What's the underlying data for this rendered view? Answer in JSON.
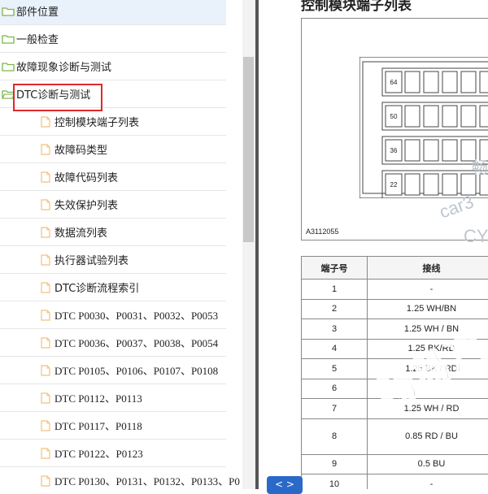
{
  "tree": {
    "folders": [
      {
        "label": "部件位置"
      },
      {
        "label": "一般检查"
      },
      {
        "label": "故障现象诊断与测试"
      },
      {
        "label": "DTC诊断与测试"
      }
    ],
    "pages": [
      {
        "label": "控制模块端子列表"
      },
      {
        "label": "故障码类型"
      },
      {
        "label": "故障代码列表"
      },
      {
        "label": "失效保护列表"
      },
      {
        "label": "数据流列表"
      },
      {
        "label": "执行器试验列表"
      },
      {
        "label": "DTC诊断流程索引"
      },
      {
        "label": "DTC P0030、P0031、P0032、P0053"
      },
      {
        "label": "DTC P0036、P0037、P0038、P0054"
      },
      {
        "label": "DTC P0105、P0106、P0107、P0108"
      },
      {
        "label": "DTC P0112、P0113"
      },
      {
        "label": "DTC P0117、P0118"
      },
      {
        "label": "DTC P0122、P0123"
      },
      {
        "label": "DTC P0130、P0131、P0132、P0133、P0"
      }
    ]
  },
  "doc": {
    "title": "控制模块端子列表",
    "figure_label": "A3112055",
    "connector_pins": [
      "64",
      "50",
      "36",
      "22"
    ],
    "table": {
      "headers": [
        "端子号",
        "接线"
      ],
      "rows": [
        [
          "1",
          "-"
        ],
        [
          "2",
          "1.25 WH/BN"
        ],
        [
          "3",
          "1.25 WH / BN"
        ],
        [
          "4",
          "1.25 BK/RD"
        ],
        [
          "5",
          "1.25 BK / RD"
        ],
        [
          "6",
          ""
        ],
        [
          "7",
          "1.25 WH / RD"
        ],
        [
          "8",
          "0.85 RD / BU"
        ],
        [
          "9",
          "0.5 BU"
        ],
        [
          "10",
          "-"
        ]
      ]
    },
    "watermark_text": "畅易汽",
    "watermark_small": [
      "car3",
      "CY",
      "畅"
    ],
    "nav_label": "< >"
  },
  "colors": {
    "highlight": "#e0282c",
    "folder": "#7ab648",
    "page": "#f1c27d",
    "watermark": "#1f5aa8"
  }
}
